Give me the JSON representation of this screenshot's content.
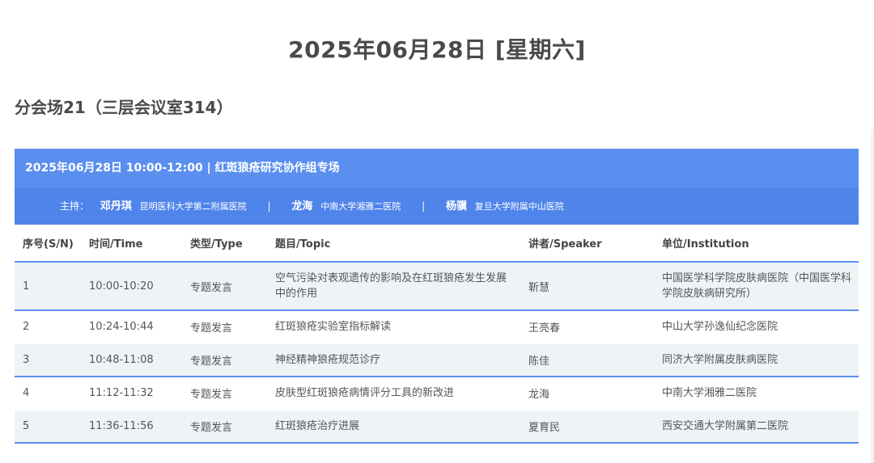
{
  "date_heading": "2025年06月28日 [星期六]",
  "venue_heading": "分会场21（三层会议室314）",
  "session": {
    "title": "2025年06月28日 10:00-12:00 | 红斑狼疮研究协作组专场",
    "hosts_label": "主持：",
    "hosts": [
      {
        "name": "邓丹琪",
        "institution": "昆明医科大学第二附属医院"
      },
      {
        "name": "龙海",
        "institution": "中南大学湘雅二医院"
      },
      {
        "name": "杨骥",
        "institution": "复旦大学附属中山医院"
      }
    ],
    "separator": "|"
  },
  "table": {
    "headers": [
      "序号(S/N)",
      "时间/Time",
      "类型/Type",
      "题目/Topic",
      "讲者/Speaker",
      "单位/Institution"
    ],
    "rows": [
      {
        "sn": "1",
        "time": "10:00-10:20",
        "type": "专题发言",
        "topic": "空气污染对表观遗传的影响及在红斑狼疮发生发展中的作用",
        "speaker": "靳慧",
        "institution": "中国医学科学院皮肤病医院（中国医学科学院皮肤病研究所）"
      },
      {
        "sn": "2",
        "time": "10:24-10:44",
        "type": "专题发言",
        "topic": "红斑狼疮实验室指标解读",
        "speaker": "王亮春",
        "institution": "中山大学孙逸仙纪念医院"
      },
      {
        "sn": "3",
        "time": "10:48-11:08",
        "type": "专题发言",
        "topic": "神经精神狼疮规范诊疗",
        "speaker": "陈佳",
        "institution": "同济大学附属皮肤病医院"
      },
      {
        "sn": "4",
        "time": "11:12-11:32",
        "type": "专题发言",
        "topic": "皮肤型红斑狼疮病情评分工具的新改进",
        "speaker": "龙海",
        "institution": "中南大学湘雅二医院"
      },
      {
        "sn": "5",
        "time": "11:36-11:56",
        "type": "专题发言",
        "topic": "红斑狼疮治疗进展",
        "speaker": "夏育民",
        "institution": "西安交通大学附属第二医院"
      }
    ]
  },
  "colors": {
    "header_blue": "#5a8ff0",
    "hosts_blue": "#4f84ea",
    "row_shade": "#eef3f6"
  }
}
